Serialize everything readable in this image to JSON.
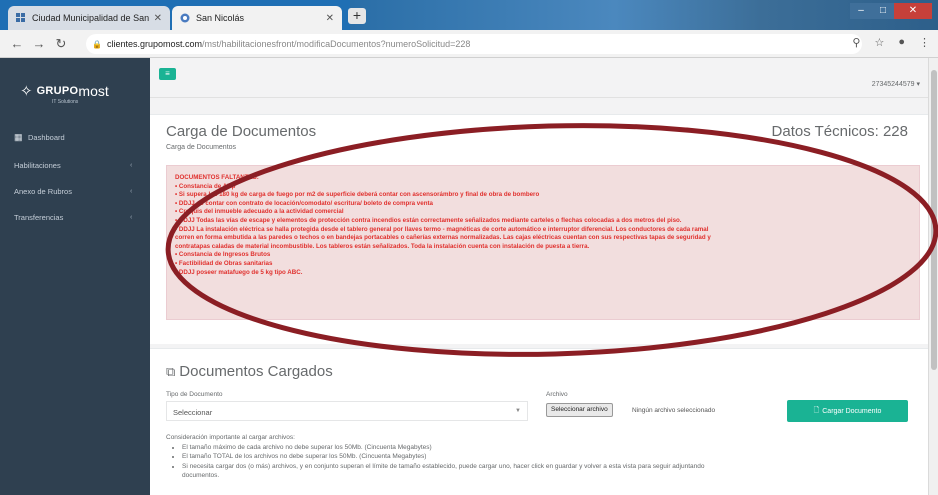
{
  "browser": {
    "tabs": [
      {
        "title": "Ciudad Municipalidad de San Ni..."
      },
      {
        "title": "San Nicolás"
      }
    ],
    "new_tab_label": "+",
    "url_host": "clientes.grupomost.com",
    "url_path": "/mst/habilitacionesfront/modificaDocumentos?numeroSolicitud=228"
  },
  "sidebar": {
    "logo": {
      "bold": "GRUPO",
      "light": "most",
      "tagline": "IT Solutions"
    },
    "items": [
      {
        "label": "Dashboard",
        "icon": "grid-icon",
        "chevron": false
      },
      {
        "label": "Habilitaciones",
        "chevron": true
      },
      {
        "label": "Anexo de Rubros",
        "chevron": true
      },
      {
        "label": "Transferencias",
        "chevron": true
      }
    ]
  },
  "topbar": {
    "menu_label": "≡",
    "user": "27345244579 ▾"
  },
  "page": {
    "title": "Carga de Documentos",
    "subtitle": "Carga de Documentos",
    "datos_label": "Datos Técnicos: 228"
  },
  "alert": {
    "heading": "DOCUMENTOS FALTANTES:",
    "lines": [
      "• Constancia de ARp",
      "• Si supera los 180 kg de carga de fuego por m2 de superficie deberá contar con ascensorámbro y final de obra de bombero",
      "• DDJJ de contar con contrato de locación/comodato/ escritura/ boleto de compra venta",
      "• Croquis del inmueble adecuado a la actividad comercial",
      "• DDJJ Todas las vías de escape y elementos de protección contra incendios están correctamente señalizados mediante carteles o flechas colocadas a dos metros del piso.",
      "• DDJJ La instalación eléctrica se halla protegida desde el tablero general por llaves termo - magnéticas de corte automático e interruptor diferencial. Los conductores de cada ramal",
      "corren en forma embutida a las paredes o techos o en bandejas portacables o cañerías externas normalizadas. Las cajas eléctricas cuentan con sus respectivas tapas de seguridad y",
      "contratapas caladas de material incombustible. Los tableros están señalizados. Toda la instalación cuenta con instalación de puesta a tierra.",
      "• Constancia de Ingresos Brutos",
      "• Factibilidad de Obras sanitarias",
      "• DDJJ poseer matafuego de 5 kg tipo ABC."
    ]
  },
  "cargados": {
    "title": "Documentos Cargados",
    "tipo_label": "Tipo de Documento",
    "tipo_value": "Seleccionar",
    "archivo_label": "Archivo",
    "file_button": "Seleccionar archivo",
    "file_status": "Ningún archivo seleccionado",
    "submit_label": "Cargar Documento",
    "consideracion_title": "Consideración importante al cargar archivos:",
    "consideraciones": [
      "El tamaño máximo de cada archivo no debe superar los 50Mb. (Cincuenta Megabytes)",
      "El tamaño TOTAL de los archivos no debe superar los 50Mb. (Cincuenta Megabytes)",
      "Si necesita cargar dos (o más) archivos, y en conjunto superan el límite de tamaño establecido, puede cargar uno, hacer click en guardar y volver a esta vista para seguir adjuntando",
      "documentos."
    ]
  },
  "colors": {
    "sidebar": "#2f4050",
    "accent": "#1ab394",
    "alert_text": "#e0312e",
    "alert_bg": "#f2dede",
    "annotation": "#8b1e24"
  }
}
